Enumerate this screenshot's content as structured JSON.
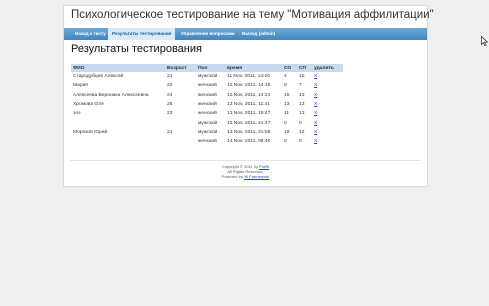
{
  "header": {
    "title": "Психологическое тестирование на тему \"Мотивация аффилитации\""
  },
  "menu": [
    {
      "label": "Назад к тесту"
    },
    {
      "label": "Результаты тестирования"
    },
    {
      "label": "Управление вопросами"
    },
    {
      "label": "Выход (admin)"
    }
  ],
  "main": {
    "heading": "Результаты тестирования"
  },
  "table": {
    "columns": [
      "ФИО",
      "Возраст",
      "Пол",
      "время",
      "СО",
      "СП",
      "удалить"
    ],
    "rows": [
      [
        "Стародубцев Алексей",
        "21",
        "мужской",
        "11 Nov, 2011, 14:20",
        "4",
        "10",
        "X"
      ],
      [
        "Мария",
        "22",
        "женский",
        "12 Nov, 2011, 14:16",
        "8",
        "7",
        "X"
      ],
      [
        "Алексеева Вероника Алексеевна",
        "24",
        "женский",
        "12 Nov, 2011, 14:24",
        "15",
        "13",
        "X"
      ],
      [
        "Хромова Оля",
        "25",
        "женский",
        "13 Nov, 2011, 11:41",
        "13",
        "13",
        "X"
      ],
      [
        "эээ",
        "23",
        "женский",
        "13 Nov, 2011, 19:47",
        "11",
        "13",
        "X"
      ],
      [
        "",
        "",
        "мужской",
        "13 Nov, 2011, 21:47",
        "0",
        "0",
        "X"
      ],
      [
        "Морозов Юрий",
        "21",
        "мужской",
        "13 Nov, 2011, 21:59",
        "19",
        "12",
        "X"
      ],
      [
        "",
        "",
        "женский",
        "14 Nov, 2011, 06:40",
        "0",
        "0",
        "X"
      ]
    ]
  },
  "footer": {
    "copyright_prefix": "Copyright © 2011 by",
    "copyright_link": "ProfB",
    "rights": "All Rights Reserved.",
    "powered_prefix": "Powered by",
    "powered_link": "Yii Framework"
  }
}
